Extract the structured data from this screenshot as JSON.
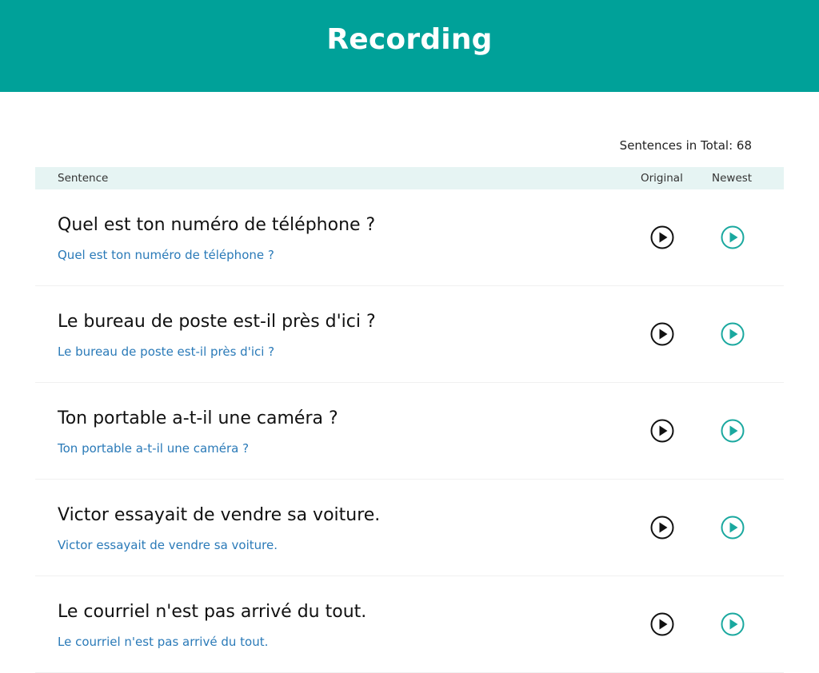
{
  "header": {
    "title": "Recording"
  },
  "summary": {
    "total_label": "Sentences in Total: 68"
  },
  "table": {
    "columns": {
      "sentence": "Sentence",
      "original": "Original",
      "newest": "Newest"
    },
    "rows": [
      {
        "sentence": "Quel est ton numéro de téléphone ?",
        "transcript": "Quel est ton numéro de téléphone ?"
      },
      {
        "sentence": "Le bureau de poste est-il près d'ici ?",
        "transcript": "Le bureau de poste est-il près d'ici ?"
      },
      {
        "sentence": "Ton portable a-t-il une caméra ?",
        "transcript": "Ton portable a-t-il une caméra ?"
      },
      {
        "sentence": "Victor essayait de vendre sa voiture.",
        "transcript": "Victor essayait de vendre sa voiture."
      },
      {
        "sentence": "Le courriel n'est pas arrivé du tout.",
        "transcript": "Le courriel n'est pas arrivé du tout."
      }
    ]
  },
  "colors": {
    "brand": "#00a199",
    "original_icon": "#111111",
    "newest_icon": "#1aa89f",
    "transcript": "#2a7ab8"
  },
  "icons": {
    "original_play": "play-circle-icon",
    "newest_play": "play-circle-icon"
  }
}
